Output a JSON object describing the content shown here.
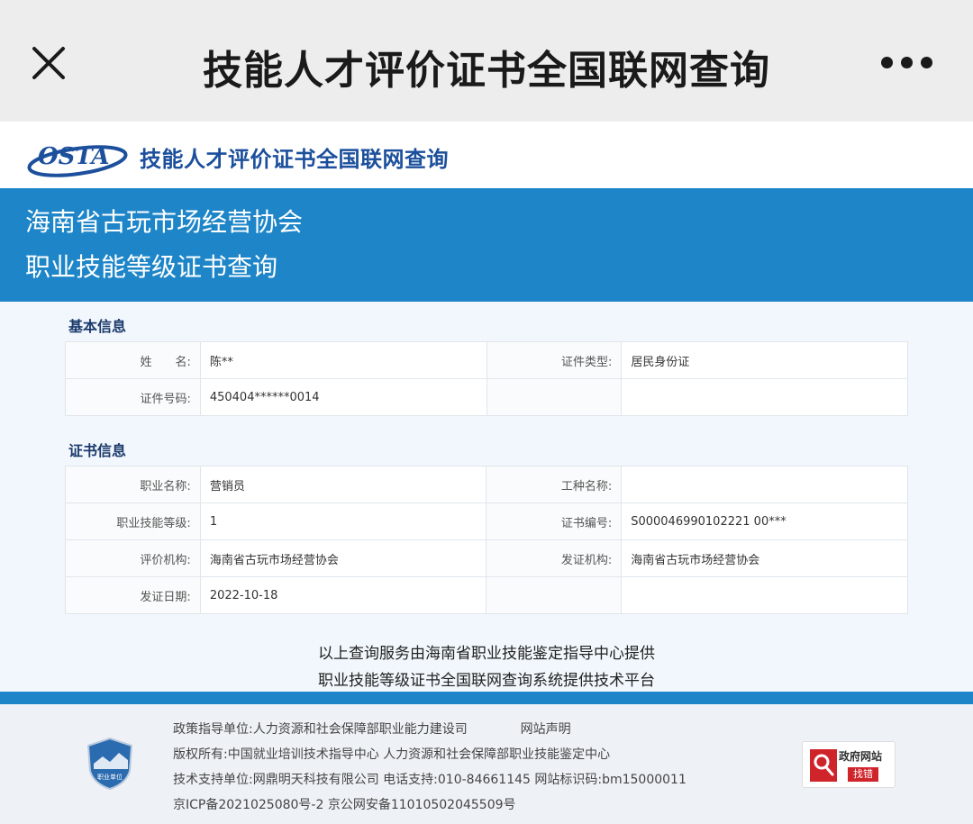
{
  "appbar": {
    "title": "技能人才评价证书全国联网查询",
    "close_icon": "close-icon",
    "more_icon": "more-icon"
  },
  "site": {
    "logo_text": "OSTA",
    "title": "技能人才评价证书全国联网查询"
  },
  "banner": {
    "line1": "海南省古玩市场经营协会",
    "line2": "职业技能等级证书查询"
  },
  "basic": {
    "section_title": "基本信息",
    "name_label": "姓　　名:",
    "name_value": "陈**",
    "idtype_label": "证件类型:",
    "idtype_value": "居民身份证",
    "idno_label": "证件号码:",
    "idno_value": "450404******0014"
  },
  "cert": {
    "section_title": "证书信息",
    "occupation_label": "职业名称:",
    "occupation_value": "营销员",
    "worktype_label": "工种名称:",
    "worktype_value": "",
    "level_label": "职业技能等级:",
    "level_value": "1",
    "certno_label": "证书编号:",
    "certno_value": "S000046990102221 00***",
    "org_label": "评价机构:",
    "org_value": "海南省古玩市场经营协会",
    "issuer_label": "发证机构:",
    "issuer_value": "海南省古玩市场经营协会",
    "date_label": "发证日期:",
    "date_value": "2022-10-18"
  },
  "notice": {
    "line1": "以上查询服务由海南省职业技能鉴定指导中心提供",
    "line2": "职业技能等级证书全国联网查询系统提供技术平台"
  },
  "footer": {
    "emblem_text": "职业单位",
    "policy": "政策指导单位:人力资源和社会保障部职业能力建设司",
    "statement": "网站声明",
    "copyright": "版权所有:中国就业培训技术指导中心 人力资源和社会保障部职业技能鉴定中心",
    "support": "技术支持单位:网鼎明天科技有限公司  电话支持:010-84661145  网站标识码:bm15000011",
    "icp": "京ICP备2021025080号-2  京公网安备11010502045509号",
    "gov_label": "政府网站",
    "gov_badge": "找错"
  },
  "colors": {
    "brand_blue": "#1e86c8",
    "title_blue": "#1c4f9c",
    "accent_red": "#d0242b"
  }
}
